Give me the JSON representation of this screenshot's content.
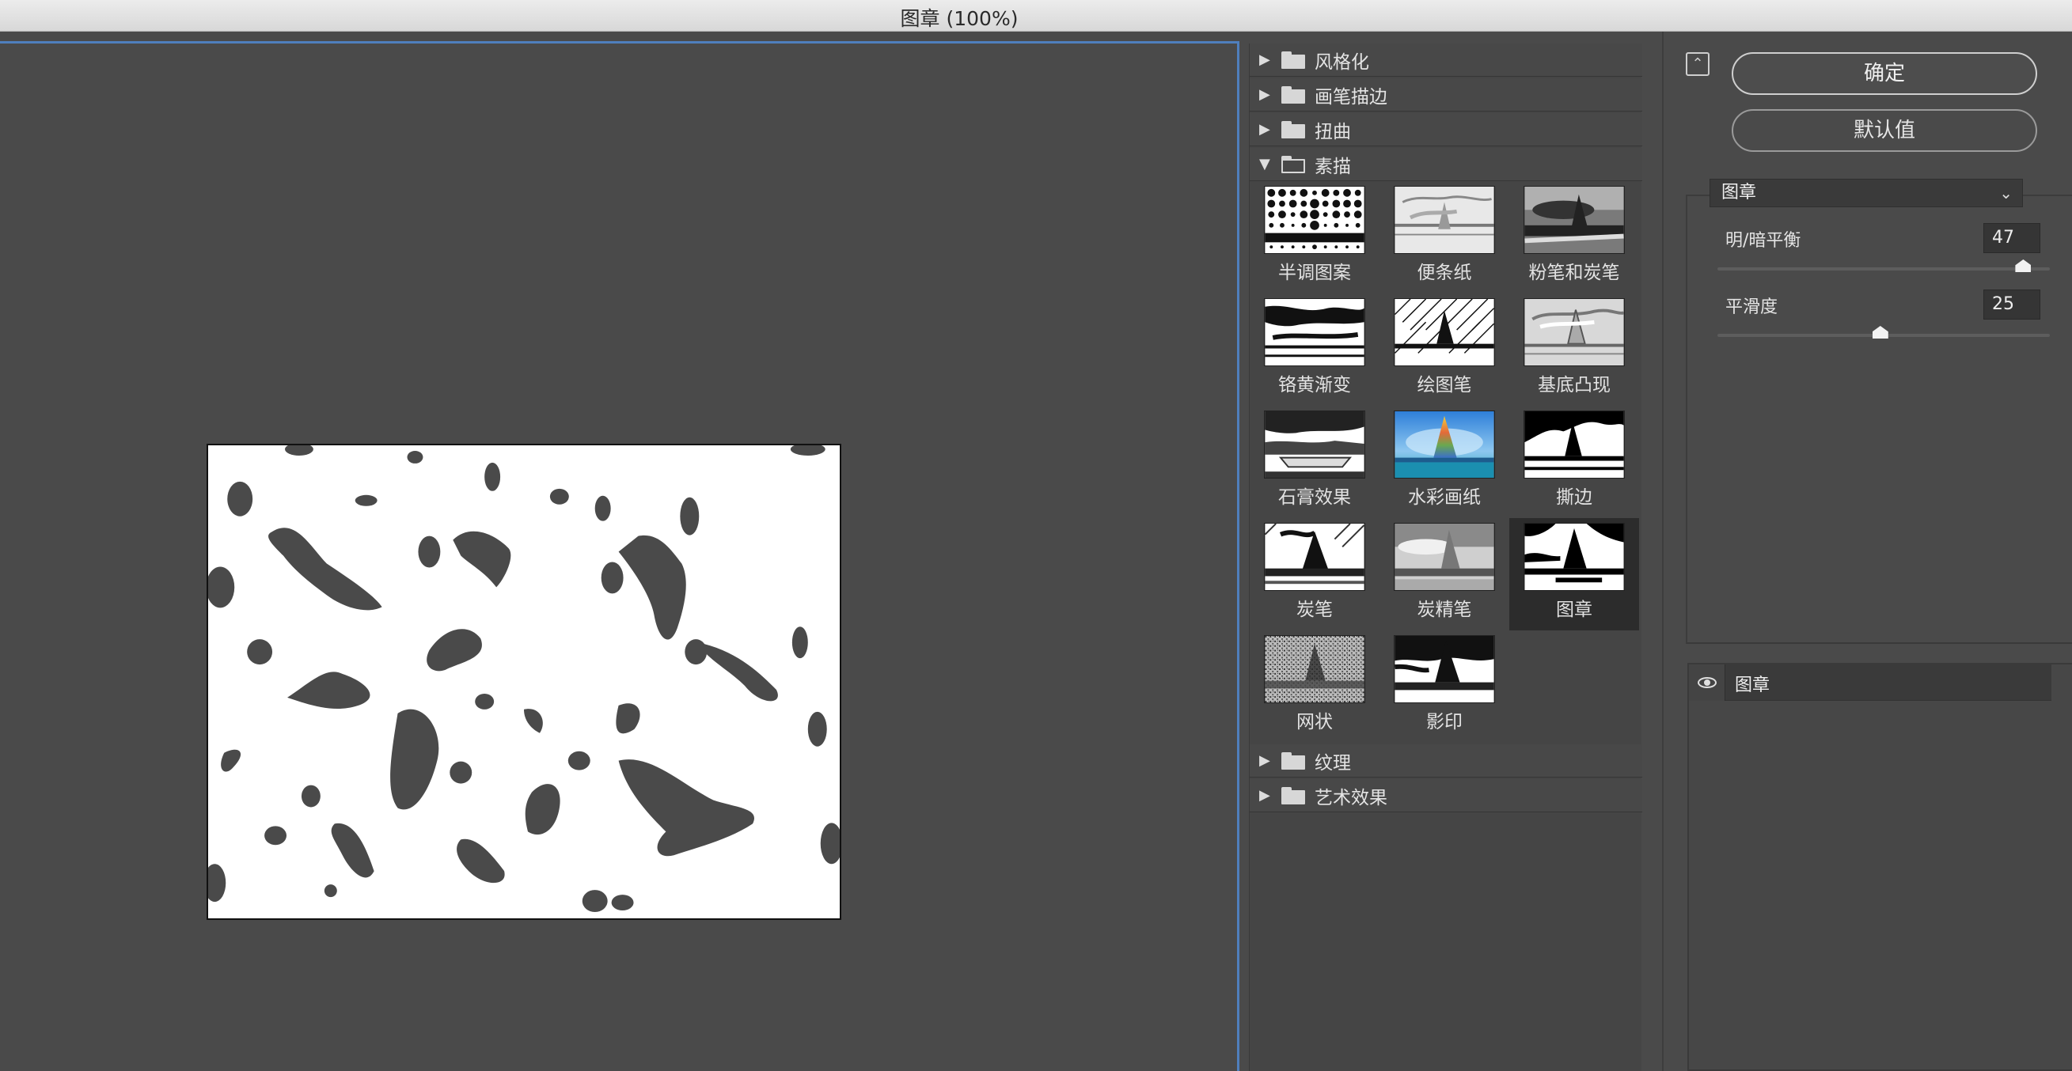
{
  "window": {
    "title": "图章 (100%)"
  },
  "filter_groups_top": [
    {
      "label": "风格化",
      "expanded": false
    },
    {
      "label": "画笔描边",
      "expanded": false
    },
    {
      "label": "扭曲",
      "expanded": false
    },
    {
      "label": "素描",
      "expanded": true
    }
  ],
  "sketch_filters": [
    {
      "label": "半调图案"
    },
    {
      "label": "便条纸"
    },
    {
      "label": "粉笔和炭笔"
    },
    {
      "label": "铬黄渐变"
    },
    {
      "label": "绘图笔"
    },
    {
      "label": "基底凸现"
    },
    {
      "label": "石膏效果"
    },
    {
      "label": "水彩画纸"
    },
    {
      "label": "撕边"
    },
    {
      "label": "炭笔"
    },
    {
      "label": "炭精笔"
    },
    {
      "label": "图章",
      "selected": true
    },
    {
      "label": "网状"
    },
    {
      "label": "影印"
    }
  ],
  "filter_groups_bottom": [
    {
      "label": "纹理",
      "expanded": false
    },
    {
      "label": "艺术效果",
      "expanded": false
    }
  ],
  "buttons": {
    "ok": "确定",
    "default": "默认值"
  },
  "filter_select": {
    "value": "图章"
  },
  "params": [
    {
      "label": "明/暗平衡",
      "value": "47",
      "fraction": 0.92
    },
    {
      "label": "平滑度",
      "value": "25",
      "fraction": 0.49
    }
  ],
  "layers": [
    {
      "name": "图章",
      "visible": true
    }
  ],
  "icons": {
    "collapse": "collapse-up-icon",
    "eye": "eye-icon",
    "folder": "folder-icon",
    "chevron": "chevron-down-icon"
  }
}
